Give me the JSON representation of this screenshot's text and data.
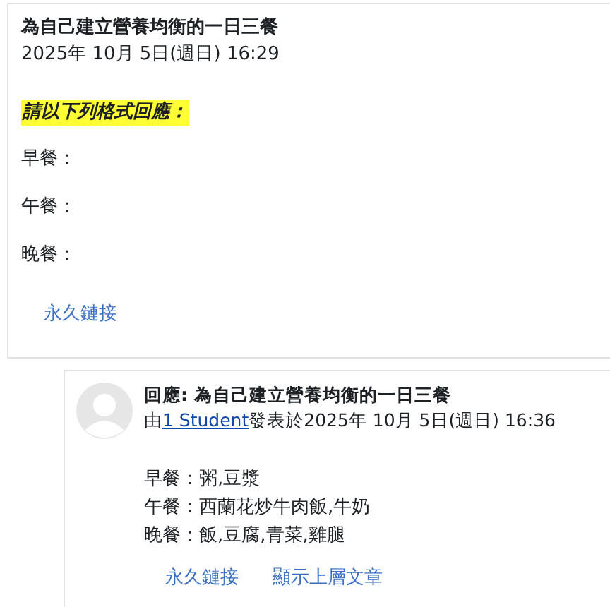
{
  "post": {
    "title": "為自己建立營養均衡的一日三餐",
    "date": "2025年 10月 5日(週日) 16:29",
    "highlight": "請以下列格式回應：",
    "lines": [
      "早餐：",
      "午餐：",
      "晚餐："
    ],
    "links": [
      "永久鏈接"
    ]
  },
  "reply": {
    "title": "回應: 為自己建立營養均衡的一日三餐",
    "byline_prefix": "由",
    "author": "1 Student",
    "byline_suffix": "發表於2025年 10月 5日(週日) 16:36",
    "lines": [
      "早餐：粥,豆漿",
      "午餐：西蘭花炒牛肉飯,牛奶",
      "晚餐：飯,豆腐,青菜,雞腿"
    ],
    "links": [
      "永久鏈接",
      "顯示上層文章"
    ]
  }
}
